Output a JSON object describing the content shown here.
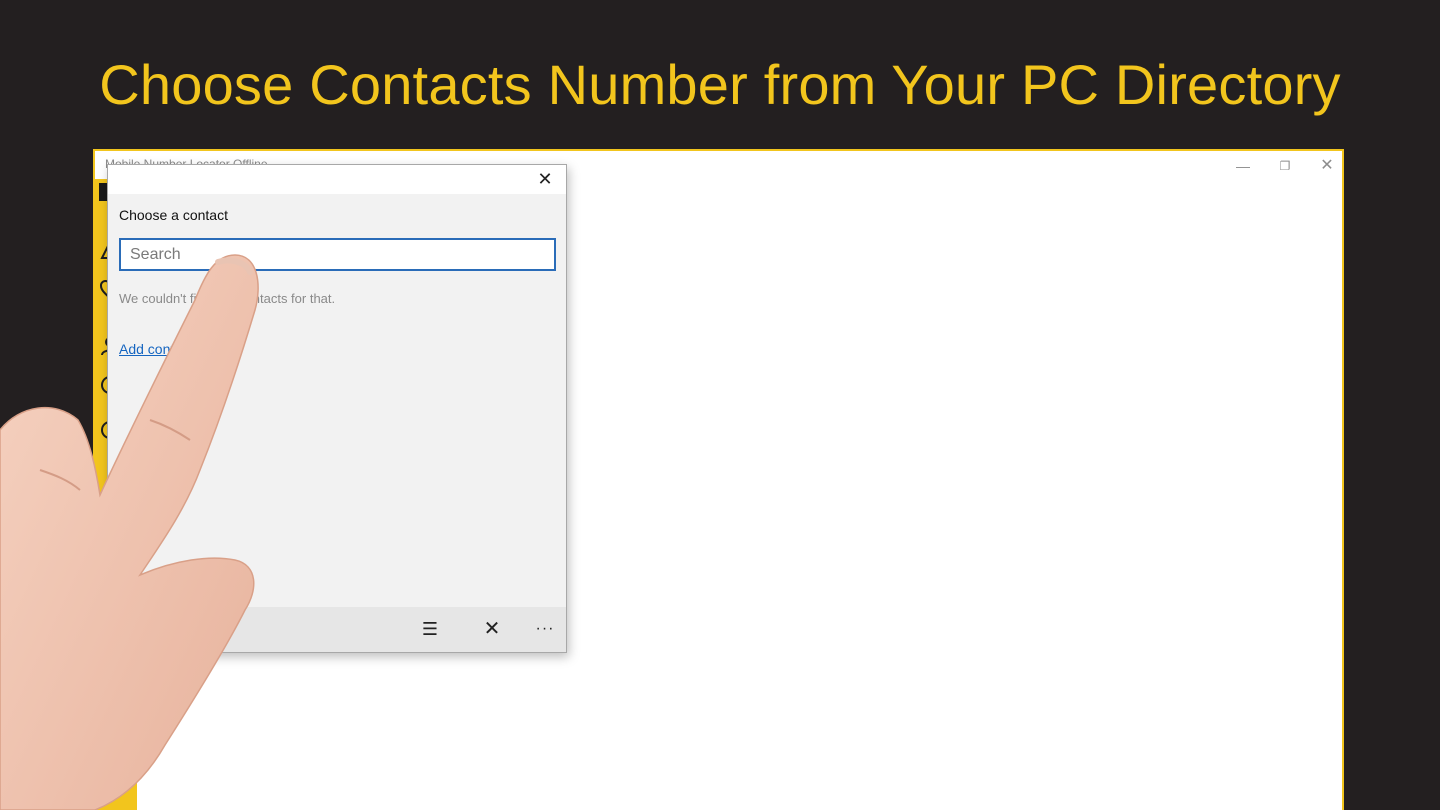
{
  "headline": "Choose Contacts Number from Your PC Directory",
  "app_window": {
    "title": "Mobile Number Locator Offline",
    "minimize_glyph": "—",
    "restore_glyph": "❐",
    "close_glyph": "✕"
  },
  "dialog": {
    "close_glyph": "✕",
    "title": "Choose a contact",
    "search_placeholder": "Search",
    "no_results_text": "We couldn't find any contacts for that.",
    "add_contact_link": "Add contact"
  },
  "command_bar": {
    "select_glyph": "☰",
    "cancel_glyph": "✕",
    "more_glyph": "···"
  },
  "colors": {
    "background": "#231f20",
    "accent_yellow": "#f2c51d",
    "search_border": "#2a6cb8",
    "link": "#1565c0"
  }
}
